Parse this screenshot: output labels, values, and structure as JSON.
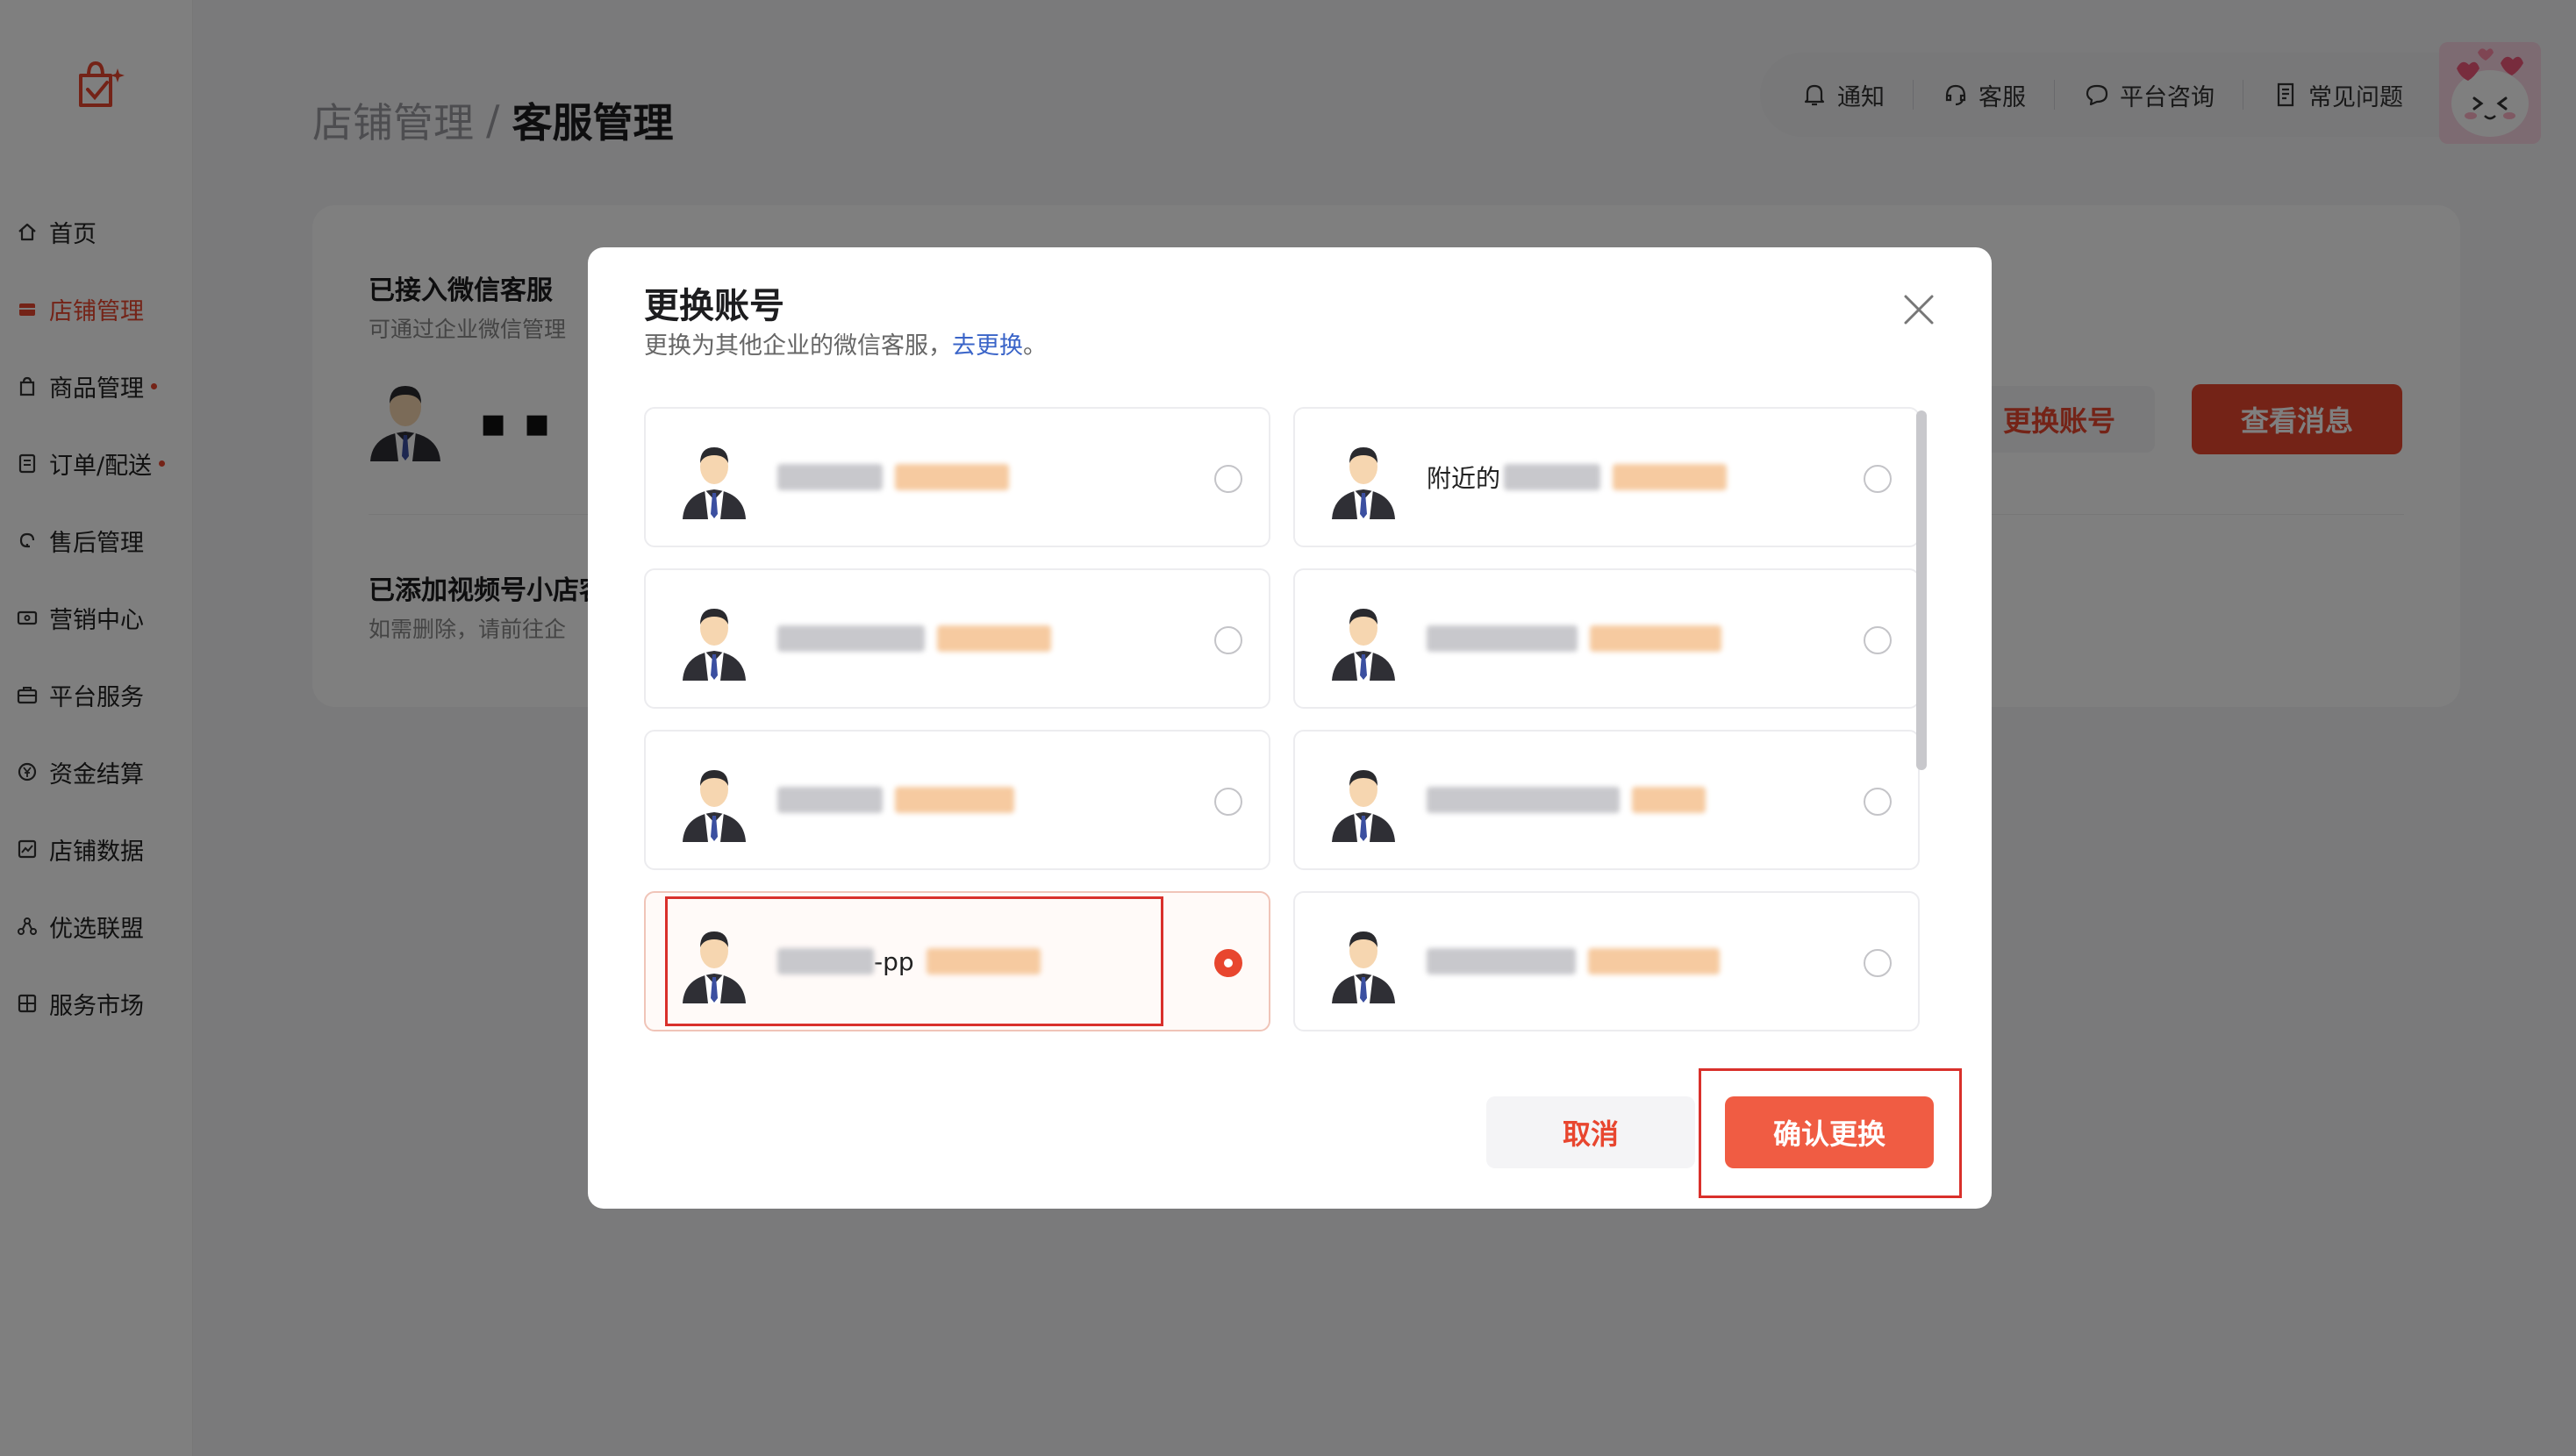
{
  "sidebar": {
    "items": [
      {
        "label": "首页",
        "icon": "home-icon",
        "active": false,
        "dot": false
      },
      {
        "label": "店铺管理",
        "icon": "store-icon",
        "active": true,
        "dot": false
      },
      {
        "label": "商品管理",
        "icon": "bag-icon",
        "active": false,
        "dot": true
      },
      {
        "label": "订单/配送",
        "icon": "order-icon",
        "active": false,
        "dot": true
      },
      {
        "label": "售后管理",
        "icon": "refresh-icon",
        "active": false,
        "dot": false
      },
      {
        "label": "营销中心",
        "icon": "ticket-icon",
        "active": false,
        "dot": false
      },
      {
        "label": "平台服务",
        "icon": "briefcase-icon",
        "active": false,
        "dot": false
      },
      {
        "label": "资金结算",
        "icon": "yuan-icon",
        "active": false,
        "dot": false
      },
      {
        "label": "店铺数据",
        "icon": "chart-icon",
        "active": false,
        "dot": false
      },
      {
        "label": "优选联盟",
        "icon": "network-icon",
        "active": false,
        "dot": false
      },
      {
        "label": "服务市场",
        "icon": "grid-icon",
        "active": false,
        "dot": false
      }
    ]
  },
  "header": {
    "breadcrumb_parent": "店铺管理",
    "breadcrumb_sep": "/",
    "breadcrumb_current": "客服管理"
  },
  "topbar": {
    "notify": "通知",
    "service": "客服",
    "consult": "平台咨询",
    "faq": "常见问题"
  },
  "card": {
    "wechat_title": "已接入微信客服",
    "wechat_sub": "可通过企业微信管理",
    "account_name": "■ ■",
    "switch_button": "更换账号",
    "view_button": "查看消息",
    "video_title": "已添加视频号小店客",
    "video_sub": "如需删除，请前往企"
  },
  "modal": {
    "title": "更换账号",
    "subtitle": "更换为其他企业的微信客服，",
    "subtitle_link": "去更换",
    "subtitle_end": "。",
    "cancel": "取消",
    "confirm": "确认更换",
    "accounts": [
      {
        "name": "",
        "selected": false
      },
      {
        "name": "附近的",
        "selected": false
      },
      {
        "name": "",
        "selected": false
      },
      {
        "name": "",
        "selected": false
      },
      {
        "name": "",
        "selected": false
      },
      {
        "name": "",
        "selected": false
      },
      {
        "name": "-pp",
        "selected": true
      },
      {
        "name": "",
        "selected": false
      }
    ]
  },
  "colors": {
    "accent": "#e8462f",
    "confirm": "#f05c43",
    "link": "#3a64c8",
    "highlight": "#d9302b"
  }
}
